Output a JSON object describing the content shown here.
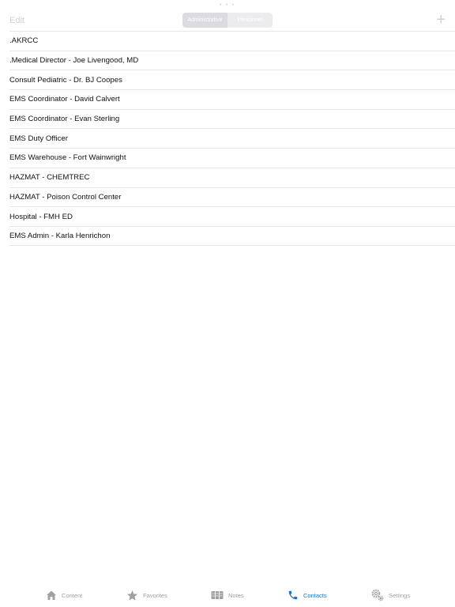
{
  "navbar": {
    "edit_label": "Edit",
    "add_label": "+",
    "segments": [
      {
        "label": "Administrative",
        "active": true
      },
      {
        "label": "Personnel",
        "active": false
      }
    ]
  },
  "contacts": [
    {
      "label": ".AKRCC"
    },
    {
      "label": ".Medical Director - Joe Livengood, MD"
    },
    {
      "label": "Consult Pediatric - Dr. BJ Coopes"
    },
    {
      "label": "EMS Coordinator - David Calvert"
    },
    {
      "label": "EMS Coordinator - Evan Sterling"
    },
    {
      "label": "EMS Duty Officer"
    },
    {
      "label": "EMS Warehouse - Fort Wainwright"
    },
    {
      "label": "HAZMAT - CHEMTREC"
    },
    {
      "label": "HAZMAT - Poison Control Center"
    },
    {
      "label": "Hospital - FMH ED"
    },
    {
      "label": "EMS Admin - Karla Henrichon"
    }
  ],
  "tabbar": {
    "active_color": "#1a6fe0",
    "inactive_color": "#a0a0a4",
    "tabs": [
      {
        "label": "Content",
        "icon": "house-icon",
        "active": false
      },
      {
        "label": "Favorites",
        "icon": "star-icon",
        "active": false
      },
      {
        "label": "Notes",
        "icon": "notes-icon",
        "active": false
      },
      {
        "label": "Contacts",
        "icon": "phone-icon",
        "active": true
      },
      {
        "label": "Settings",
        "icon": "gears-icon",
        "active": false
      }
    ]
  }
}
